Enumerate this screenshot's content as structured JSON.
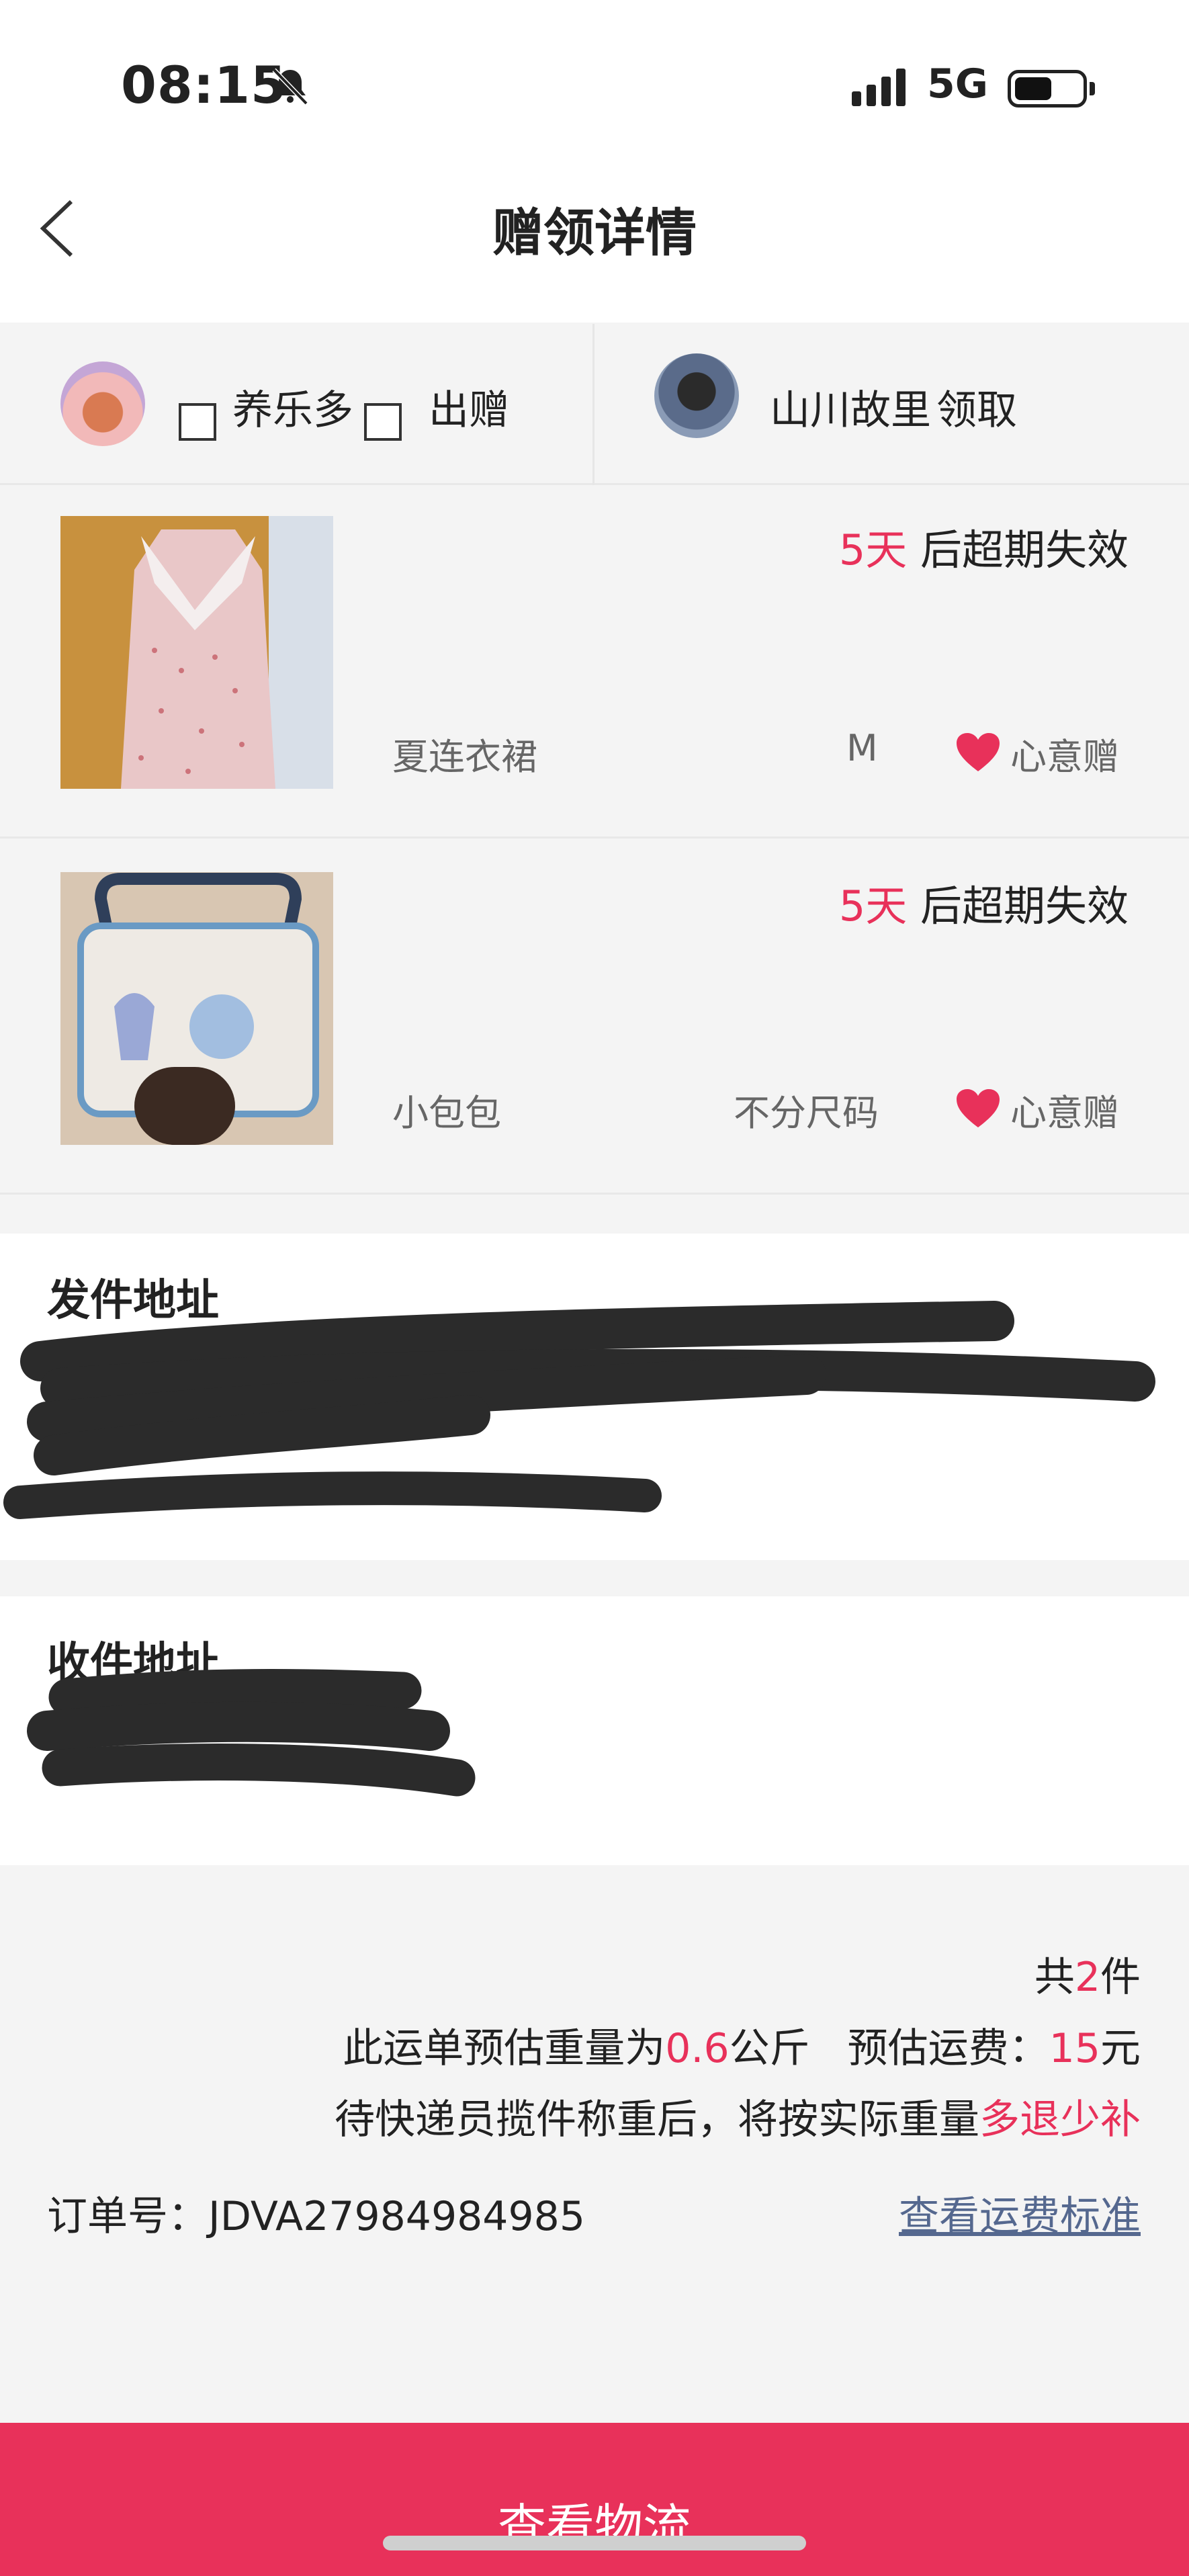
{
  "status_bar": {
    "time": "08:15",
    "network": "5G",
    "icons": [
      "bell-muted-icon",
      "signal-icon",
      "battery-icon"
    ]
  },
  "nav": {
    "title": "赠领详情",
    "back_icon": "chevron-left-icon"
  },
  "participants": {
    "giver_name": "养乐多",
    "giver_action": "出赠",
    "taker_name": "山川故里",
    "taker_action": "领取"
  },
  "items": [
    {
      "expire_num": "5天",
      "expire_suffix": " 后超期失效",
      "name": "夏连衣裙",
      "size": "M",
      "gift_type": "心意赠"
    },
    {
      "expire_num": "5天",
      "expire_suffix": " 后超期失效",
      "name": "小包包",
      "size": "不分尺码",
      "gift_type": "心意赠"
    }
  ],
  "send_address": {
    "title": "发件地址"
  },
  "receive_address": {
    "title": "收件地址"
  },
  "summary": {
    "count_prefix": "共",
    "count": "2",
    "count_suffix": "件",
    "weight_prefix": "此运单预估重量为",
    "weight": "0.6",
    "weight_unit": "公斤",
    "fee_prefix": "预估运费：",
    "fee": "15",
    "fee_unit": "元",
    "note_prefix": "待快递员揽件称重后，将按实际重量",
    "note_highlight": "多退少补",
    "order_label": "订单号：",
    "order_number": "JDVA27984984985",
    "fee_standard_link": "查看运费标准"
  },
  "bottom_button": "查看物流",
  "colors": {
    "accent": "#e8315a",
    "link": "#55688f",
    "background": "#f4f4f4"
  }
}
